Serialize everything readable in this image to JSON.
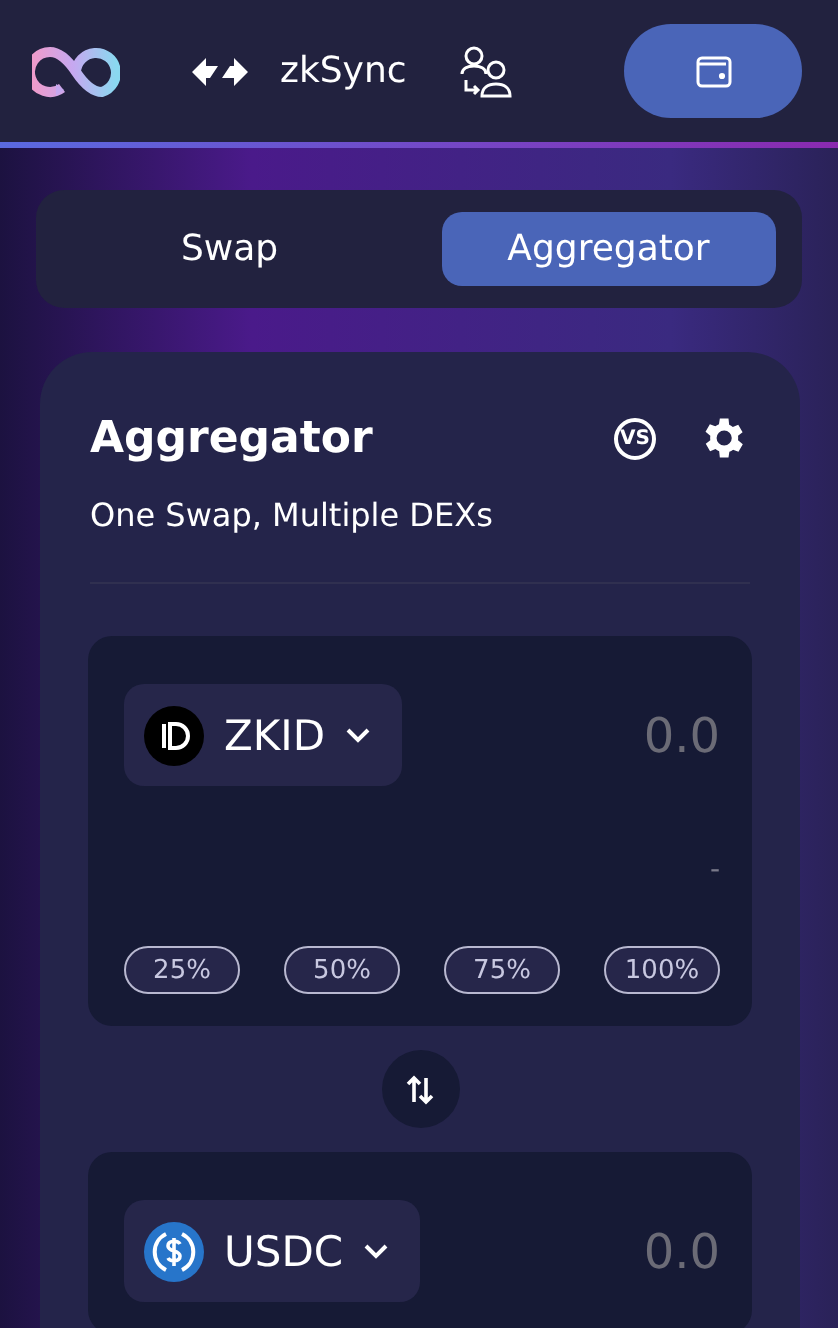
{
  "header": {
    "network": "zkSync"
  },
  "tabs": [
    {
      "label": "Swap",
      "selected": false
    },
    {
      "label": "Aggregator",
      "selected": true
    }
  ],
  "card": {
    "title": "Aggregator",
    "compare_label": "VS",
    "subtitle": "One Swap, Multiple DEXs",
    "panels": [
      {
        "token": "ZKID",
        "kind": "zkid",
        "placeholder": "0.0",
        "usd": "-",
        "percents": [
          "25%",
          "50%",
          "75%",
          "100%"
        ]
      },
      {
        "token": "USDC",
        "kind": "usdc",
        "placeholder": "0.0"
      }
    ]
  }
}
